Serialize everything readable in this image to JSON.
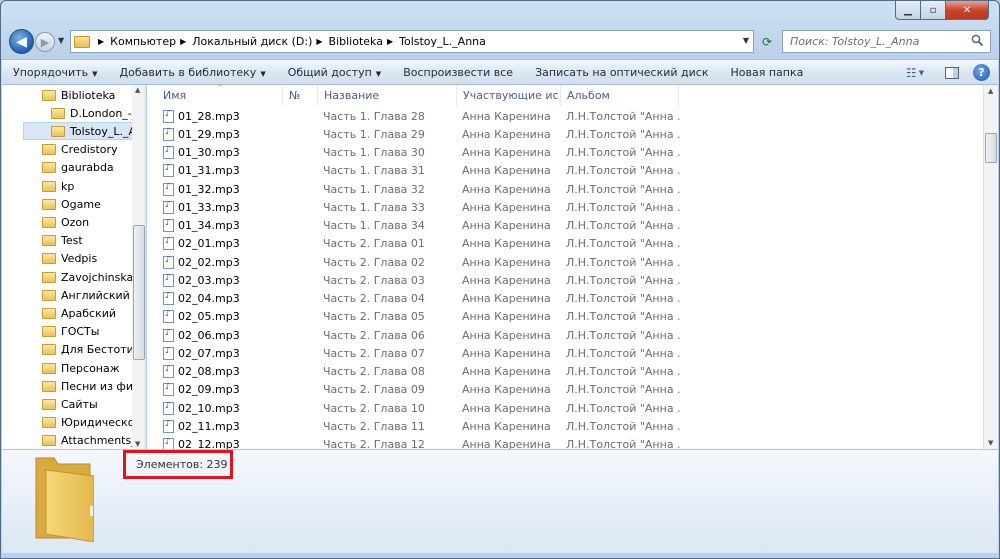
{
  "search": {
    "placeholder": "Поиск: Tolstoy_L._Anna"
  },
  "breadcrumb": [
    "Компьютер",
    "Локальный диск (D:)",
    "Biblioteka",
    "Tolstoy_L._Anna"
  ],
  "toolbar": {
    "items": [
      "Упорядочить",
      "Добавить в библиотеку",
      "Общий доступ",
      "Воспроизвести все",
      "Записать на оптический диск",
      "Новая папка"
    ],
    "dropdown_flags": [
      true,
      true,
      true,
      false,
      false,
      false
    ]
  },
  "nav": {
    "items": [
      {
        "label": "Biblioteka",
        "indent": 0
      },
      {
        "label": "D.London_-_I",
        "indent": 1
      },
      {
        "label": "Tolstoy_L._Anna",
        "indent": 1,
        "selected": true
      },
      {
        "label": "Credistory",
        "indent": 0
      },
      {
        "label": "gaurabda",
        "indent": 0
      },
      {
        "label": "kp",
        "indent": 0
      },
      {
        "label": "Ogame",
        "indent": 0
      },
      {
        "label": "Ozon",
        "indent": 0
      },
      {
        "label": "Test",
        "indent": 0
      },
      {
        "label": "Vedpis",
        "indent": 0
      },
      {
        "label": "Zavojchinskaja",
        "indent": 0
      },
      {
        "label": "Английский",
        "indent": 0
      },
      {
        "label": "Арабский",
        "indent": 0
      },
      {
        "label": "ГОСТы",
        "indent": 0
      },
      {
        "label": "Для Бестотик",
        "indent": 0
      },
      {
        "label": "Персонаж",
        "indent": 0
      },
      {
        "label": "Песни из филь",
        "indent": 0
      },
      {
        "label": "Сайты",
        "indent": 0
      },
      {
        "label": "Юридическое",
        "indent": 0
      },
      {
        "label": "Attachments_r",
        "indent": 0
      }
    ]
  },
  "columns": [
    "Имя",
    "№",
    "Название",
    "Участвующие ис...",
    "Альбом"
  ],
  "files": [
    {
      "name": "01_28.mp3",
      "title": "Часть 1. Глава 28",
      "artist": "Анна Каренина",
      "album": "Л.Н.Толстой \"Анна ..."
    },
    {
      "name": "01_29.mp3",
      "title": "Часть 1. Глава 29",
      "artist": "Анна Каренина",
      "album": "Л.Н.Толстой \"Анна ..."
    },
    {
      "name": "01_30.mp3",
      "title": "Часть 1. Глава 30",
      "artist": "Анна Каренина",
      "album": "Л.Н.Толстой \"Анна ..."
    },
    {
      "name": "01_31.mp3",
      "title": "Часть 1. Глава 31",
      "artist": "Анна Каренина",
      "album": "Л.Н.Толстой \"Анна ..."
    },
    {
      "name": "01_32.mp3",
      "title": "Часть 1. Глава 32",
      "artist": "Анна Каренина",
      "album": "Л.Н.Толстой \"Анна ..."
    },
    {
      "name": "01_33.mp3",
      "title": "Часть 1. Глава 33",
      "artist": "Анна Каренина",
      "album": "Л.Н.Толстой \"Анна ..."
    },
    {
      "name": "01_34.mp3",
      "title": "Часть 1. Глава 34",
      "artist": "Анна Каренина",
      "album": "Л.Н.Толстой \"Анна ..."
    },
    {
      "name": "02_01.mp3",
      "title": "Часть 2. Глава 01",
      "artist": "Анна Каренина",
      "album": "Л.Н.Толстой \"Анна ..."
    },
    {
      "name": "02_02.mp3",
      "title": "Часть 2. Глава 02",
      "artist": "Анна Каренина",
      "album": "Л.Н.Толстой \"Анна ..."
    },
    {
      "name": "02_03.mp3",
      "title": "Часть 2. Глава 03",
      "artist": "Анна Каренина",
      "album": "Л.Н.Толстой \"Анна ..."
    },
    {
      "name": "02_04.mp3",
      "title": "Часть 2. Глава 04",
      "artist": "Анна Каренина",
      "album": "Л.Н.Толстой \"Анна ..."
    },
    {
      "name": "02_05.mp3",
      "title": "Часть 2. Глава 05",
      "artist": "Анна Каренина",
      "album": "Л.Н.Толстой \"Анна ..."
    },
    {
      "name": "02_06.mp3",
      "title": "Часть 2. Глава 06",
      "artist": "Анна Каренина",
      "album": "Л.Н.Толстой \"Анна ..."
    },
    {
      "name": "02_07.mp3",
      "title": "Часть 2. Глава 07",
      "artist": "Анна Каренина",
      "album": "Л.Н.Толстой \"Анна ..."
    },
    {
      "name": "02_08.mp3",
      "title": "Часть 2. Глава 08",
      "artist": "Анна Каренина",
      "album": "Л.Н.Толстой \"Анна ..."
    },
    {
      "name": "02_09.mp3",
      "title": "Часть 2. Глава 09",
      "artist": "Анна Каренина",
      "album": "Л.Н.Толстой \"Анна ..."
    },
    {
      "name": "02_10.mp3",
      "title": "Часть 2. Глава 10",
      "artist": "Анна Каренина",
      "album": "Л.Н.Толстой \"Анна ..."
    },
    {
      "name": "02_11.mp3",
      "title": "Часть 2. Глава 11",
      "artist": "Анна Каренина",
      "album": "Л.Н.Толстой \"Анна ..."
    },
    {
      "name": "02_12.mp3",
      "title": "Часть 2. Глава 12",
      "artist": "Анна Каренина",
      "album": "Л.Н.Толстой \"Анна ..."
    }
  ],
  "details": {
    "item_count": "Элементов: 239"
  },
  "colors": {
    "highlight_box": "#e0141e",
    "selection": "#d9e6f5"
  },
  "icons": [
    "back-icon",
    "forward-icon",
    "folder-icon",
    "refresh-icon",
    "search-icon",
    "views-icon",
    "preview-pane-icon",
    "help-icon",
    "mp3-file-icon"
  ]
}
